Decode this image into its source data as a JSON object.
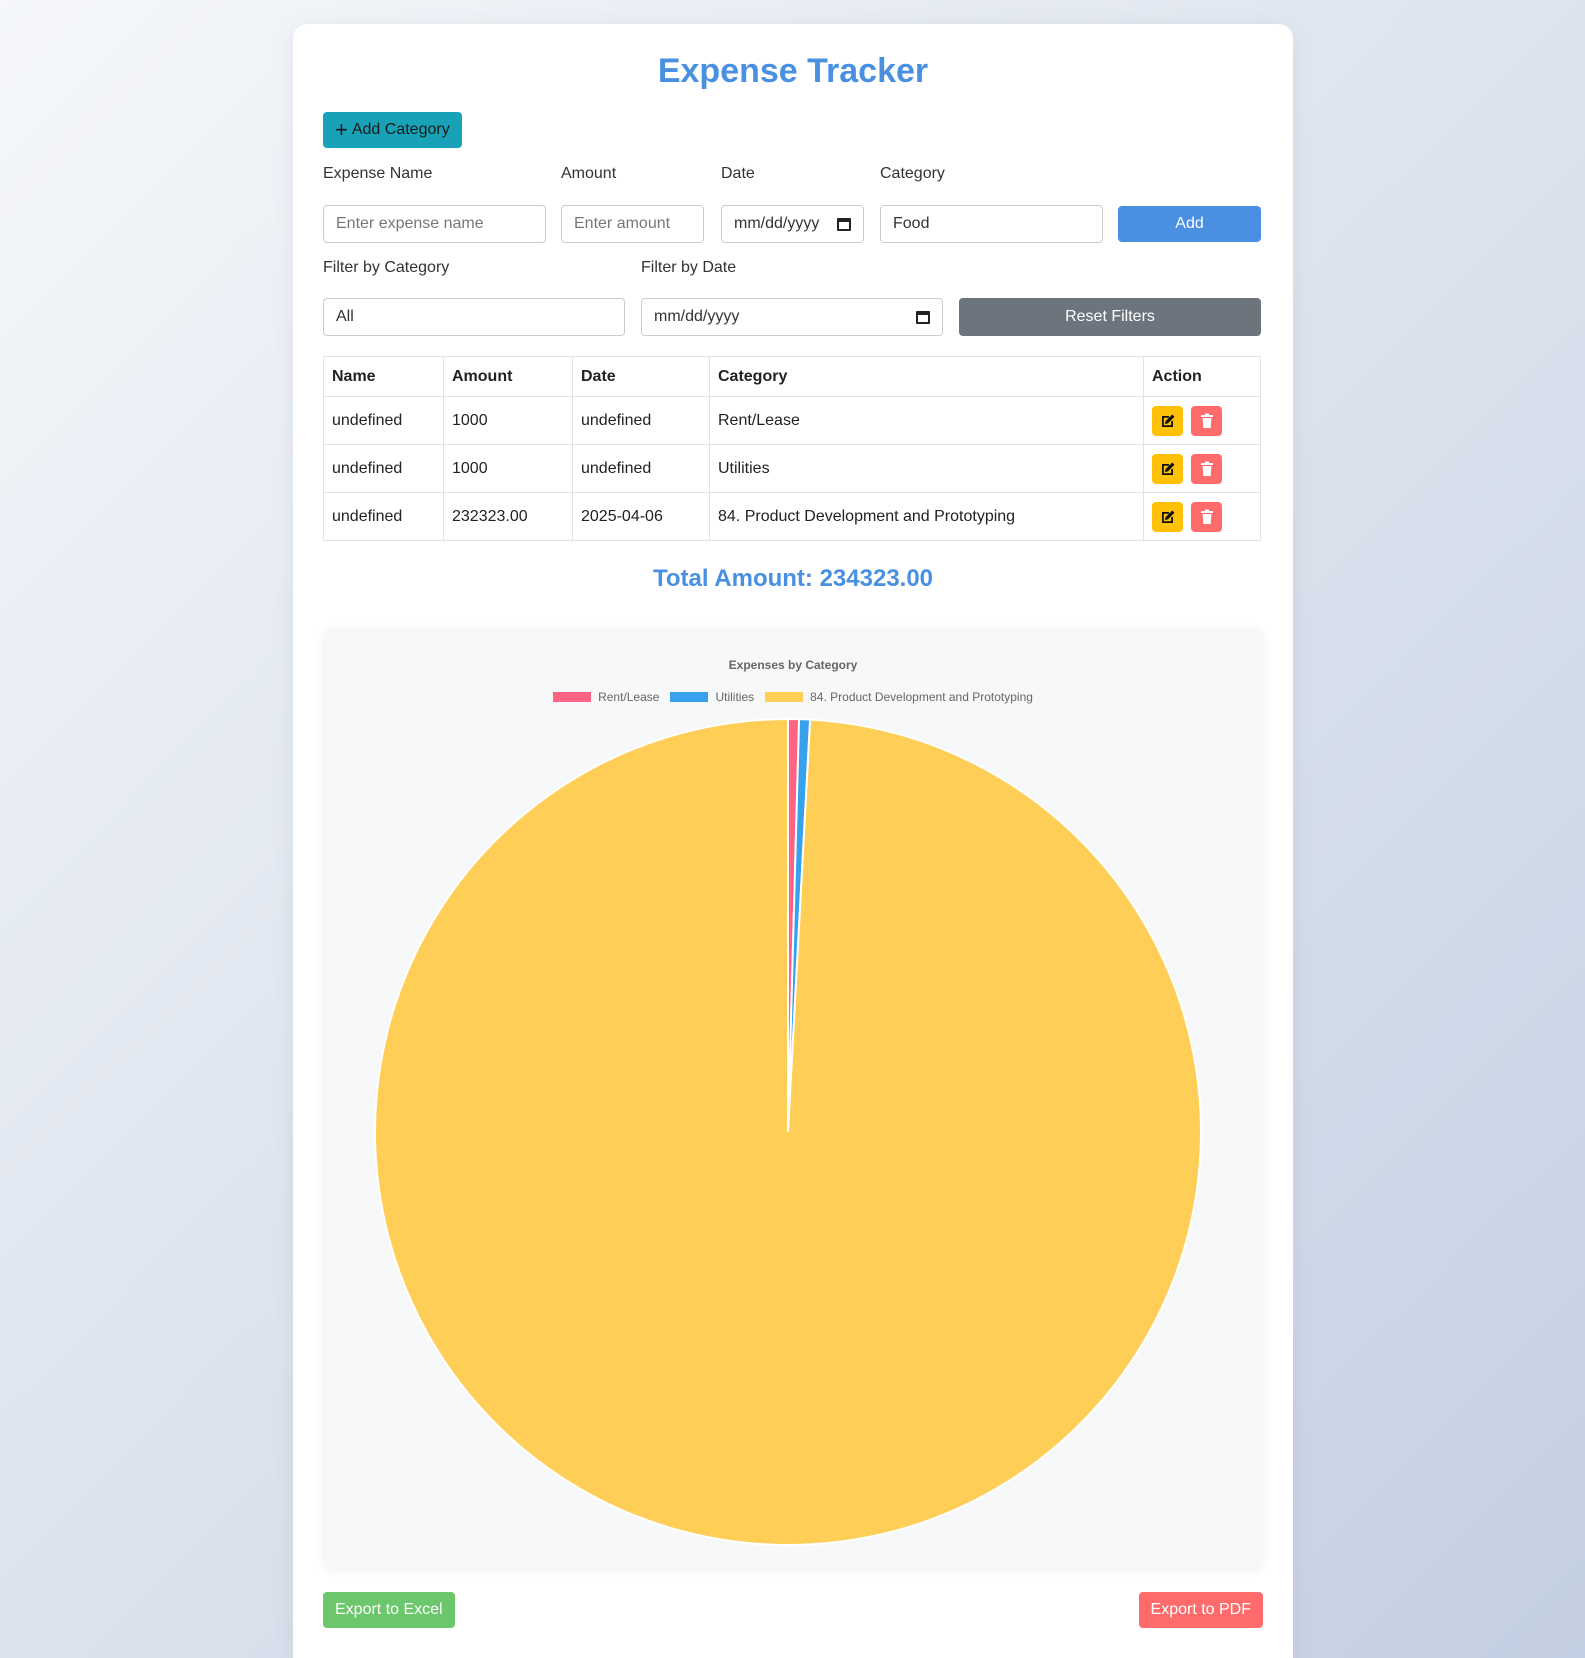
{
  "title": "Expense Tracker",
  "add_category_label": "Add Category",
  "form": {
    "name_label": "Expense Name",
    "name_placeholder": "Enter expense name",
    "amount_label": "Amount",
    "amount_placeholder": "Enter amount",
    "date_label": "Date",
    "date_value": "mm/dd/yyyy",
    "category_label": "Category",
    "category_value": "Food",
    "add_label": "Add"
  },
  "filters": {
    "category_label": "Filter by Category",
    "category_value": "All",
    "date_label": "Filter by Date",
    "date_value": "mm/dd/yyyy",
    "reset_label": "Reset Filters"
  },
  "table": {
    "headers": [
      "Name",
      "Amount",
      "Date",
      "Category",
      "Action"
    ],
    "rows": [
      [
        "undefined",
        "1000",
        "undefined",
        "Rent/Lease"
      ],
      [
        "undefined",
        "1000",
        "undefined",
        "Utilities"
      ],
      [
        "undefined",
        "232323.00",
        "2025-04-06",
        "84. Product Development and Prototyping"
      ]
    ]
  },
  "total": "Total Amount: 234323.00",
  "chart_data": {
    "type": "pie",
    "title": "Expenses by Category",
    "labels": [
      "Rent/Lease",
      "Utilities",
      "84. Product Development and Prototyping"
    ],
    "values": [
      1000,
      1000,
      232323
    ],
    "colors": [
      "#ff6384",
      "#36a2eb",
      "#ffce56"
    ],
    "legend_position": "top"
  },
  "export_excel_label": "Export to Excel",
  "export_pdf_label": "Export to PDF",
  "colors": {
    "accent": "#4a90e2",
    "info": "#17a2b8",
    "secondary": "#6c757d",
    "warning": "#ffc107",
    "danger": "#ff6b6b",
    "success": "#6cc76c"
  }
}
